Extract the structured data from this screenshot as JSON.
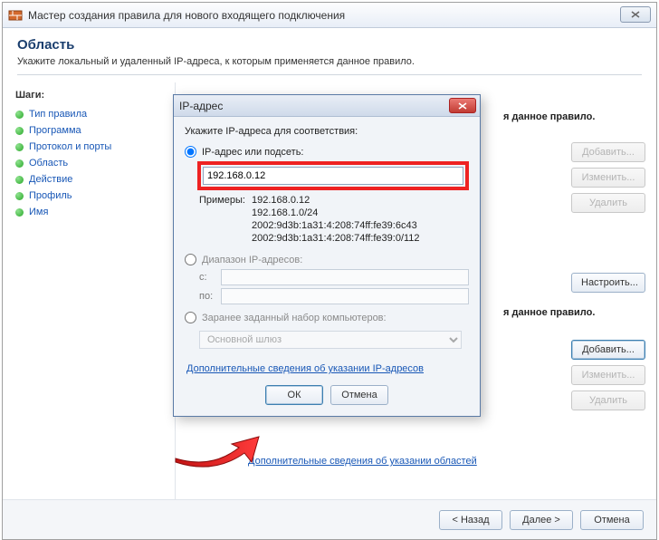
{
  "window": {
    "title": "Мастер создания правила для нового входящего подключения"
  },
  "header": {
    "title": "Область",
    "subtitle": "Укажите локальный и удаленный IP-адреса, к которым применяется данное правило."
  },
  "sidebar": {
    "steps_label": "Шаги:",
    "items": [
      {
        "label": "Тип правила"
      },
      {
        "label": "Программа"
      },
      {
        "label": "Протокол и порты"
      },
      {
        "label": "Область"
      },
      {
        "label": "Действие"
      },
      {
        "label": "Профиль"
      },
      {
        "label": "Имя"
      }
    ]
  },
  "main": {
    "rule_text_1": "я данное правило.",
    "rule_text_2": "я данное правило.",
    "btn_add": "Добавить...",
    "btn_edit": "Изменить...",
    "btn_delete": "Удалить",
    "btn_configure": "Настроить...",
    "link_areas": "Дополнительные сведения об указании областей"
  },
  "footer": {
    "back": "< Назад",
    "next": "Далее >",
    "cancel": "Отмена"
  },
  "dialog": {
    "title": "IP-адрес",
    "instruction": "Укажите IP-адреса для соответствия:",
    "radio_ip": "IP-адрес или подсеть:",
    "ip_value": "192.168.0.12",
    "examples_label": "Примеры:",
    "examples": [
      "192.168.0.12",
      "192.168.1.0/24",
      "2002:9d3b:1a31:4:208:74ff:fe39:6c43",
      "2002:9d3b:1a31:4:208:74ff:fe39:0/112"
    ],
    "radio_range": "Диапазон IP-адресов:",
    "range_from_label": "с:",
    "range_to_label": "по:",
    "radio_preset": "Заранее заданный набор компьютеров:",
    "preset_value": "Основной шлюз",
    "link_more": "Дополнительные сведения об указании IP-адресов",
    "ok": "ОК",
    "cancel": "Отмена"
  }
}
